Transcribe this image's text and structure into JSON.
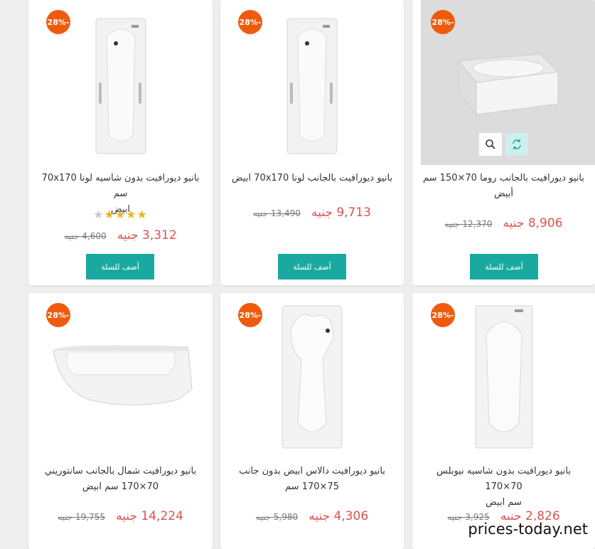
{
  "products": [
    {
      "badge": "28%-",
      "title_line1": "بانيو ديورافيت بدون شاسيه لونا 70x170 سم",
      "title_line2": "ابيض",
      "price": "3,312 جنيه",
      "old_price": "4,600 جنيه",
      "add_to_cart": "أضف للسلة",
      "rating": 4
    },
    {
      "badge": "28%-",
      "title_line1": "بانيو ديورافيت بالجانب لونا 70x170 ابيض",
      "title_line2": "",
      "price": "9,713 جنيه",
      "old_price": "13,490 جنيه",
      "add_to_cart": "أضف للسلة"
    },
    {
      "badge": "28%-",
      "title_line1": "بانيو ديورافيت بالجانب روما 70×150 سم",
      "title_line2": "أبيض",
      "price": "8,906 جنيه",
      "old_price": "12,370 جنيه",
      "add_to_cart": "أضف للسلة"
    },
    {
      "badge": "28%-",
      "title_line1": "بانيو ديورافيت شمال بالجانب سانتوريني",
      "title_line2": "70×170 سم ابيض",
      "price": "14,224 جنيه",
      "old_price": "19,755 جنيه"
    },
    {
      "badge": "28%-",
      "title_line1": "بانيو ديورافيت دالاس ابيض بدون جانب",
      "title_line2": "75×170 سم",
      "price": "4,306 جنيه",
      "old_price": "5,980 جنيه"
    },
    {
      "badge": "28%-",
      "title_line1": "بانيو ديورافيت بدون شاسيه نيوبلس 70×170",
      "title_line2": "سم ابيض",
      "price": "2,826 جنيه",
      "old_price": "3,925 جنيه"
    }
  ],
  "icons": {
    "quick_view": "search-icon",
    "compare": "refresh-icon"
  },
  "colors": {
    "badge": "#ef5b0c",
    "button": "#1aa9a1",
    "price": "#d9534f"
  },
  "watermark": "prices-today.net"
}
